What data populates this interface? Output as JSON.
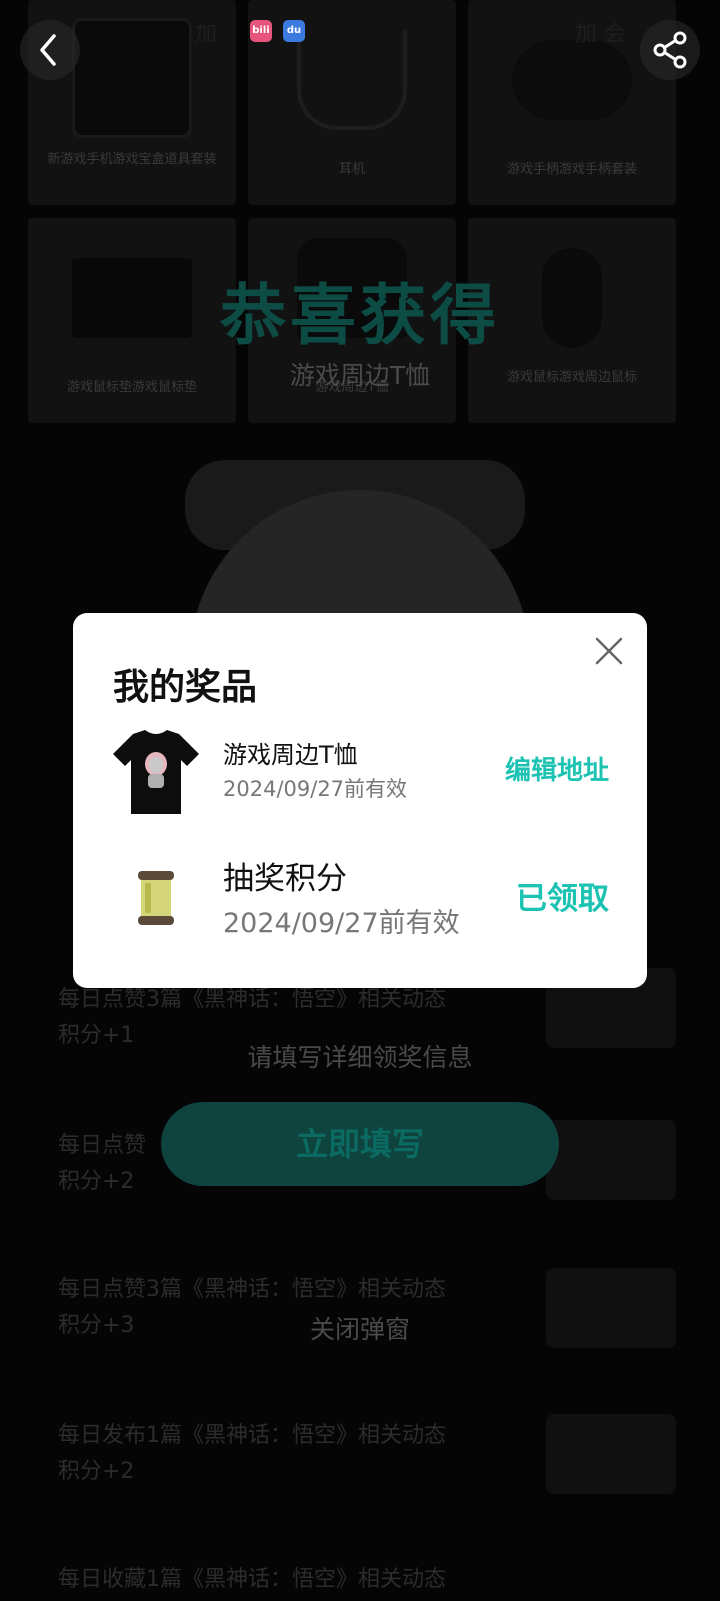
{
  "header": {
    "back_icon": "chevron-left-icon",
    "share_icon": "share-icon",
    "status_text_left": "加",
    "status_text_right": "加 会"
  },
  "background": {
    "grid_items": [
      {
        "label": "新游戏手机游戏宝盒道具套装"
      },
      {
        "label": "耳机"
      },
      {
        "label": "游戏手柄游戏手柄套装"
      },
      {
        "label": "游戏鼠标垫游戏鼠标垫"
      },
      {
        "label": "游戏周边T恤"
      },
      {
        "label": "游戏鼠标游戏周边鼠标"
      }
    ],
    "congrats_title": "恭喜获得",
    "won_prize": "游戏周边T恤",
    "hint": "请填写详细领奖信息",
    "fill_button": "立即填写",
    "close_popup": "关闭弹窗",
    "tasks": [
      {
        "line1": "每日点赞3篇《黑神话：悟空》相关动态",
        "line2": "积分+1"
      },
      {
        "line1": "每日点赞",
        "line2": "积分+2"
      },
      {
        "line1": "每日点赞3篇《黑神话：悟空》相关动态",
        "line2": "积分+3"
      },
      {
        "line1": "每日发布1篇《黑神话：悟空》相关动态",
        "line2": "积分+2"
      },
      {
        "line1": "每日收藏1篇《黑神话：悟空》相关动态",
        "line2": ""
      }
    ]
  },
  "modal": {
    "title": "我的奖品",
    "close_icon": "close-icon",
    "prizes": [
      {
        "name": "游戏周边T恤",
        "valid": "2024/09/27前有效",
        "action": "编辑地址",
        "image": "tshirt-image"
      },
      {
        "name": "抽奖积分",
        "valid": "2024/09/27前有效",
        "action": "已领取",
        "image": "points-scroll-image"
      }
    ]
  },
  "colors": {
    "accent": "#1cc3b3",
    "modal_bg": "#ffffff",
    "overlay": "#000000"
  }
}
